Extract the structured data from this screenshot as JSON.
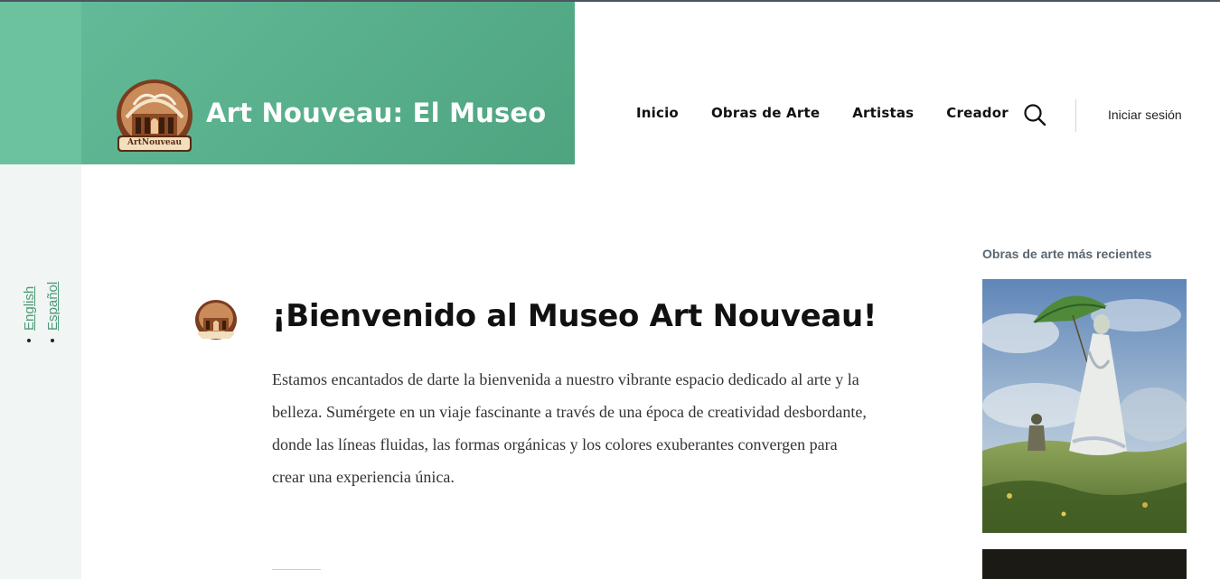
{
  "header": {
    "site_title": "Art Nouveau: El Museo",
    "logo_text": "ArtNouveau",
    "nav": [
      {
        "label": "Inicio"
      },
      {
        "label": "Obras de Arte"
      },
      {
        "label": "Artistas"
      },
      {
        "label": "Creador"
      }
    ],
    "search_icon": "search-icon",
    "login_label": "Iniciar sesión"
  },
  "languages": [
    {
      "label": "English"
    },
    {
      "label": "Español"
    }
  ],
  "post": {
    "title": "¡Bienvenido al Museo Art Nouveau!",
    "body": "Estamos encantados de darte la bienvenida a nuestro vibrante espacio dedicado al arte y la belleza. Sumérgete en un viaje fascinante a través de una época de creatividad desbordante, donde las líneas fluidas, las formas orgánicas y los colores exuberantes convergen para crear una experiencia única."
  },
  "sidebar": {
    "widget_title": "Obras de arte más recientes"
  },
  "colors": {
    "brand_green": "#4ea47f",
    "brand_light": "#6cc19f",
    "link": "#4a9a78",
    "text": "#111111"
  }
}
